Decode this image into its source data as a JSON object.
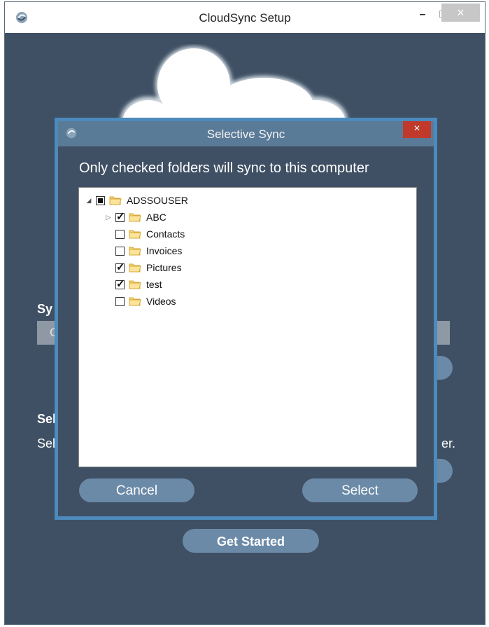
{
  "main_window": {
    "title": "CloudSync Setup",
    "controls": {
      "minimize": "–",
      "maximize": "□",
      "close": "×"
    }
  },
  "background": {
    "sync_heading_partial": "Sy",
    "input_partial": "C",
    "select_heading_partial": "Sel",
    "select_text_partial": "Sel",
    "select_text_end": "er.",
    "get_started_label": "Get Started"
  },
  "dialog": {
    "title": "Selective Sync",
    "close": "×",
    "instruction": "Only checked folders will sync to this computer",
    "tree": {
      "root": {
        "label": "ADSSOUSER",
        "state": "partial",
        "expanded": true
      },
      "children": [
        {
          "label": "ABC",
          "checked": true,
          "has_children": true
        },
        {
          "label": "Contacts",
          "checked": false,
          "has_children": false
        },
        {
          "label": "Invoices",
          "checked": false,
          "has_children": false
        },
        {
          "label": "Pictures",
          "checked": true,
          "has_children": false
        },
        {
          "label": "test",
          "checked": true,
          "has_children": false
        },
        {
          "label": "Videos",
          "checked": false,
          "has_children": false
        }
      ]
    },
    "cancel_label": "Cancel",
    "select_label": "Select"
  },
  "colors": {
    "window_bg": "#3f5064",
    "dialog_border": "#4b8bbd",
    "button_bg": "#6b8aa7",
    "close_red": "#c0392b"
  }
}
